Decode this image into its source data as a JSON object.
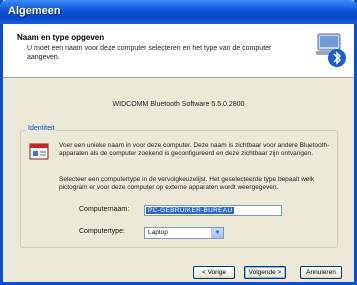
{
  "window": {
    "title": "Algemeen"
  },
  "header": {
    "title": "Naam en type opgeven",
    "subtitle": "U moet een naam voor deze computer selecteren en het type van de computer aangeven."
  },
  "version": "WIDCOMM Bluetooth Software 5.5.0.2800",
  "group": {
    "legend": "Identiteit",
    "paragraph1": "Voer een unieke naam in voor deze computer. Deze naam is zichtbaar voor andere Bluetooth-apparaten als de computer zoekend is geconfigureerd en deze zichtbaar zijn ontvangen.",
    "paragraph2": "Selecteer een computertype in de vervolgkeuzelijst. Het geselecteerde type bepaalt welk pictogram er voor deze computer op externe apparaten wordt weergegeven."
  },
  "form": {
    "name_label": "Computernaam:",
    "name_value": "PC-GEBRUIKER-BUREAU",
    "type_label": "Computertype:",
    "type_value": "Laptop"
  },
  "buttons": {
    "back": "< Vorige",
    "next": "Volgende >",
    "cancel": "Annuleren"
  }
}
